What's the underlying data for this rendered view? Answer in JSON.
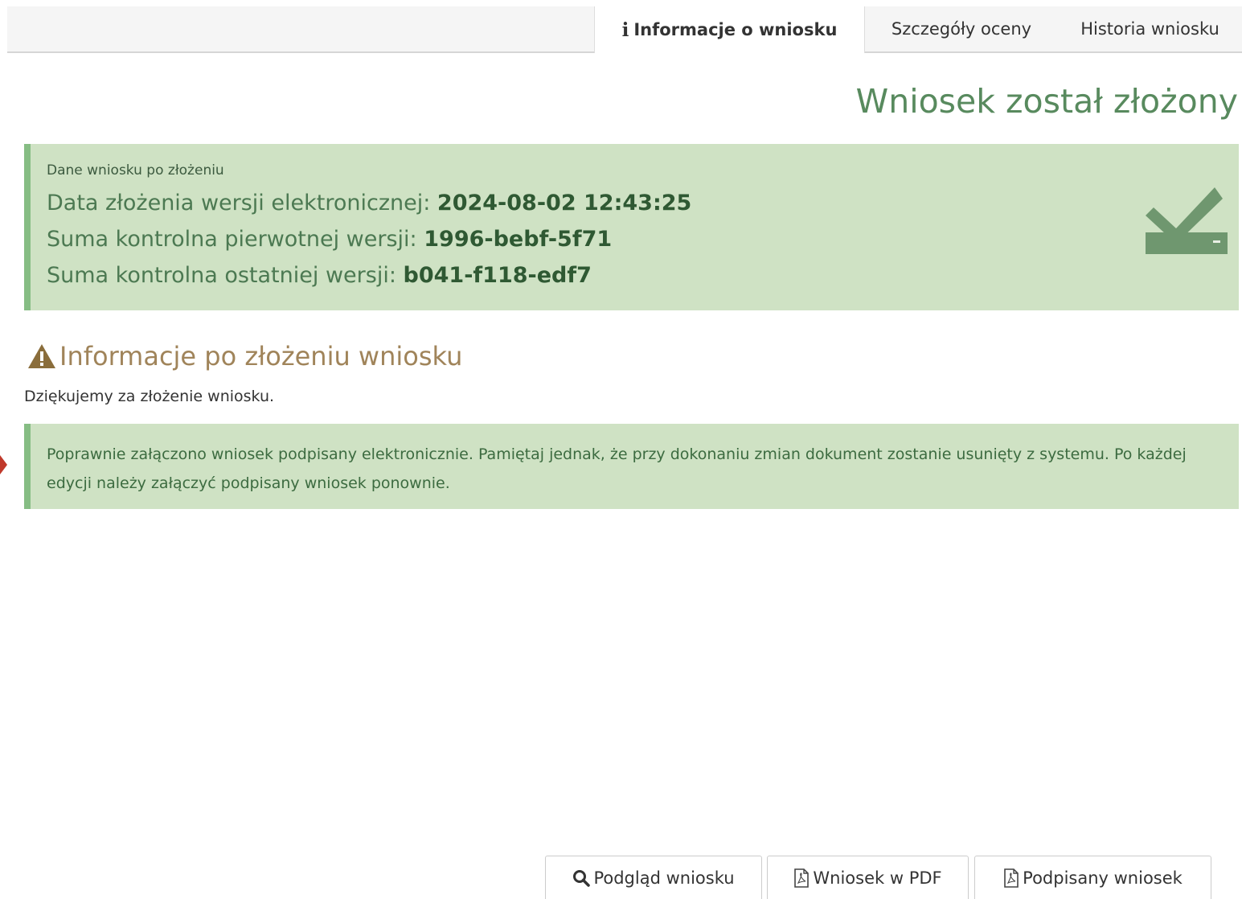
{
  "tabs": [
    {
      "label": "Informacje o wniosku",
      "icon": "info-icon",
      "active": true
    },
    {
      "label": "Szczegóły oceny",
      "active": false
    },
    {
      "label": "Historia wniosku",
      "active": false
    }
  ],
  "title": "Wniosek został złożony",
  "submission": {
    "caption": "Dane wniosku po złożeniu",
    "rows": [
      {
        "label": "Data złożenia wersji elektronicznej:",
        "value": "2024-08-02 12:43:25"
      },
      {
        "label": "Suma kontrolna pierwotnej wersji:",
        "value": "1996-bebf-5f71"
      },
      {
        "label": "Suma kontrolna ostatniej wersji:",
        "value": "b041-f118-edf7"
      }
    ],
    "status_icon": "check-inbox-icon"
  },
  "info_section": {
    "icon": "warning-icon",
    "heading": "Informacje po złożeniu wniosku",
    "thanks": "Dziękujemy za złożenie wniosku.",
    "notice": "Poprawnie załączono wniosek podpisany elektronicznie. Pamiętaj jednak, że przy dokonaniu zmian dokument zostanie usunięty z systemu. Po każdej edycji należy załączyć podpisany wniosek ponownie."
  },
  "buttons": [
    {
      "label": "Podgląd wniosku",
      "icon": "search-icon"
    },
    {
      "label": "Wniosek w PDF",
      "icon": "pdf-file-icon"
    },
    {
      "label": "Podpisany wniosek",
      "icon": "pdf-file-icon"
    }
  ],
  "colors": {
    "success_bg": "#cfe2c4",
    "success_border": "#86bd84",
    "title_green": "#588a5e",
    "heading_brown": "#a0845a"
  }
}
